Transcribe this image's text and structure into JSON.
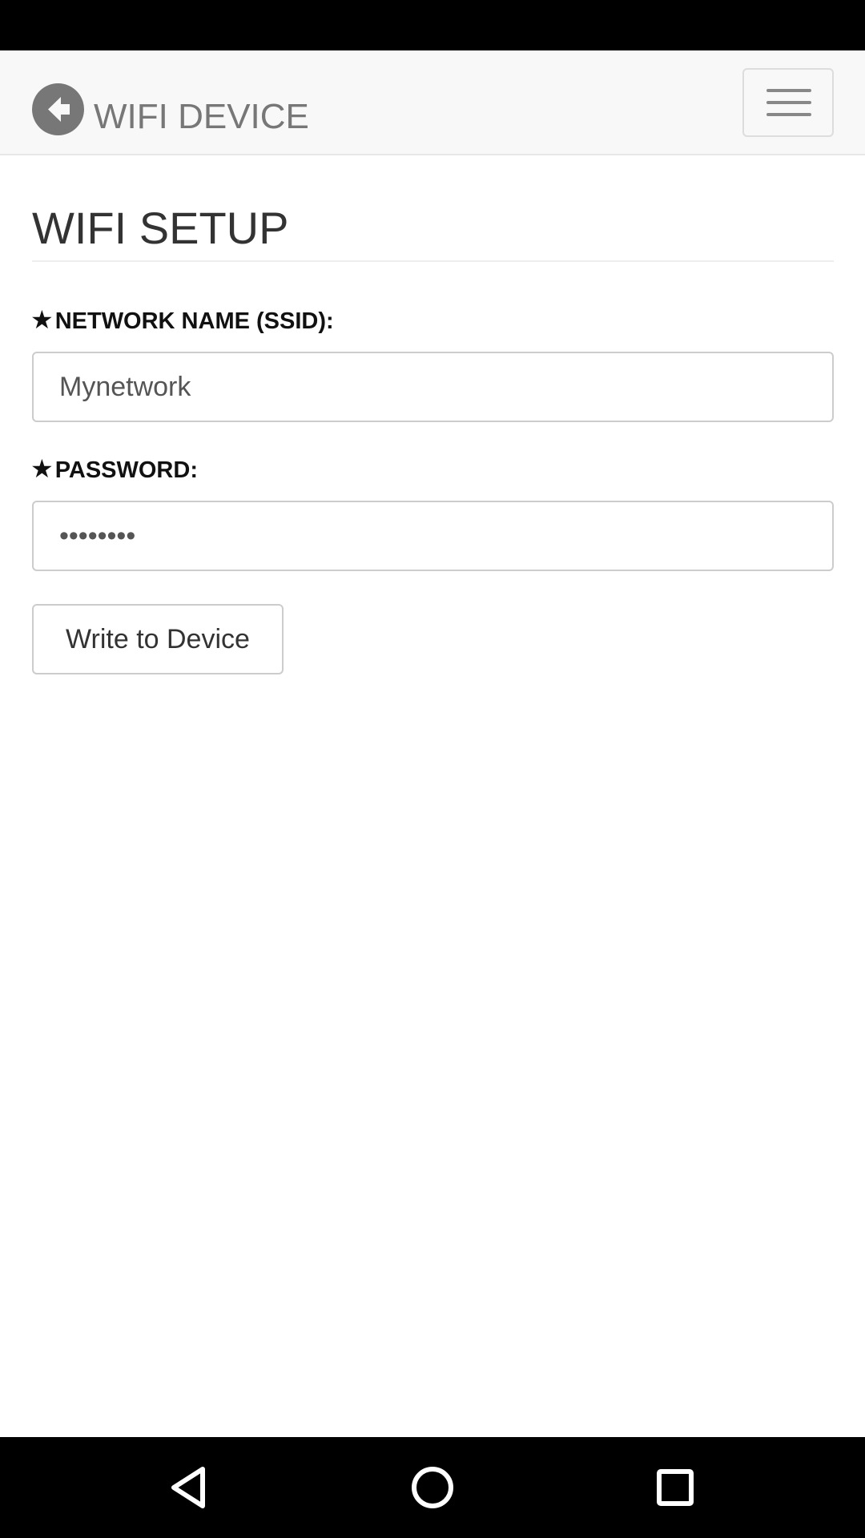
{
  "navbar": {
    "title": "WIFI DEVICE",
    "back_icon": "arrow-circle-left-icon",
    "menu_icon": "hamburger-menu-icon"
  },
  "page": {
    "heading": "WIFI SETUP"
  },
  "form": {
    "ssid": {
      "required_marker": "★",
      "label": "NETWORK NAME (SSID):",
      "value": "Mynetwork"
    },
    "password": {
      "required_marker": "★",
      "label": "PASSWORD:",
      "value": "••••••••"
    },
    "submit_label": "Write to Device"
  },
  "system_nav": {
    "back_icon": "triangle-back-icon",
    "home_icon": "circle-home-icon",
    "recents_icon": "square-recents-icon"
  },
  "colors": {
    "status_bar": "#000000",
    "navbar_bg": "#f8f8f8",
    "muted_text": "#777777",
    "input_border": "#cccccc"
  }
}
